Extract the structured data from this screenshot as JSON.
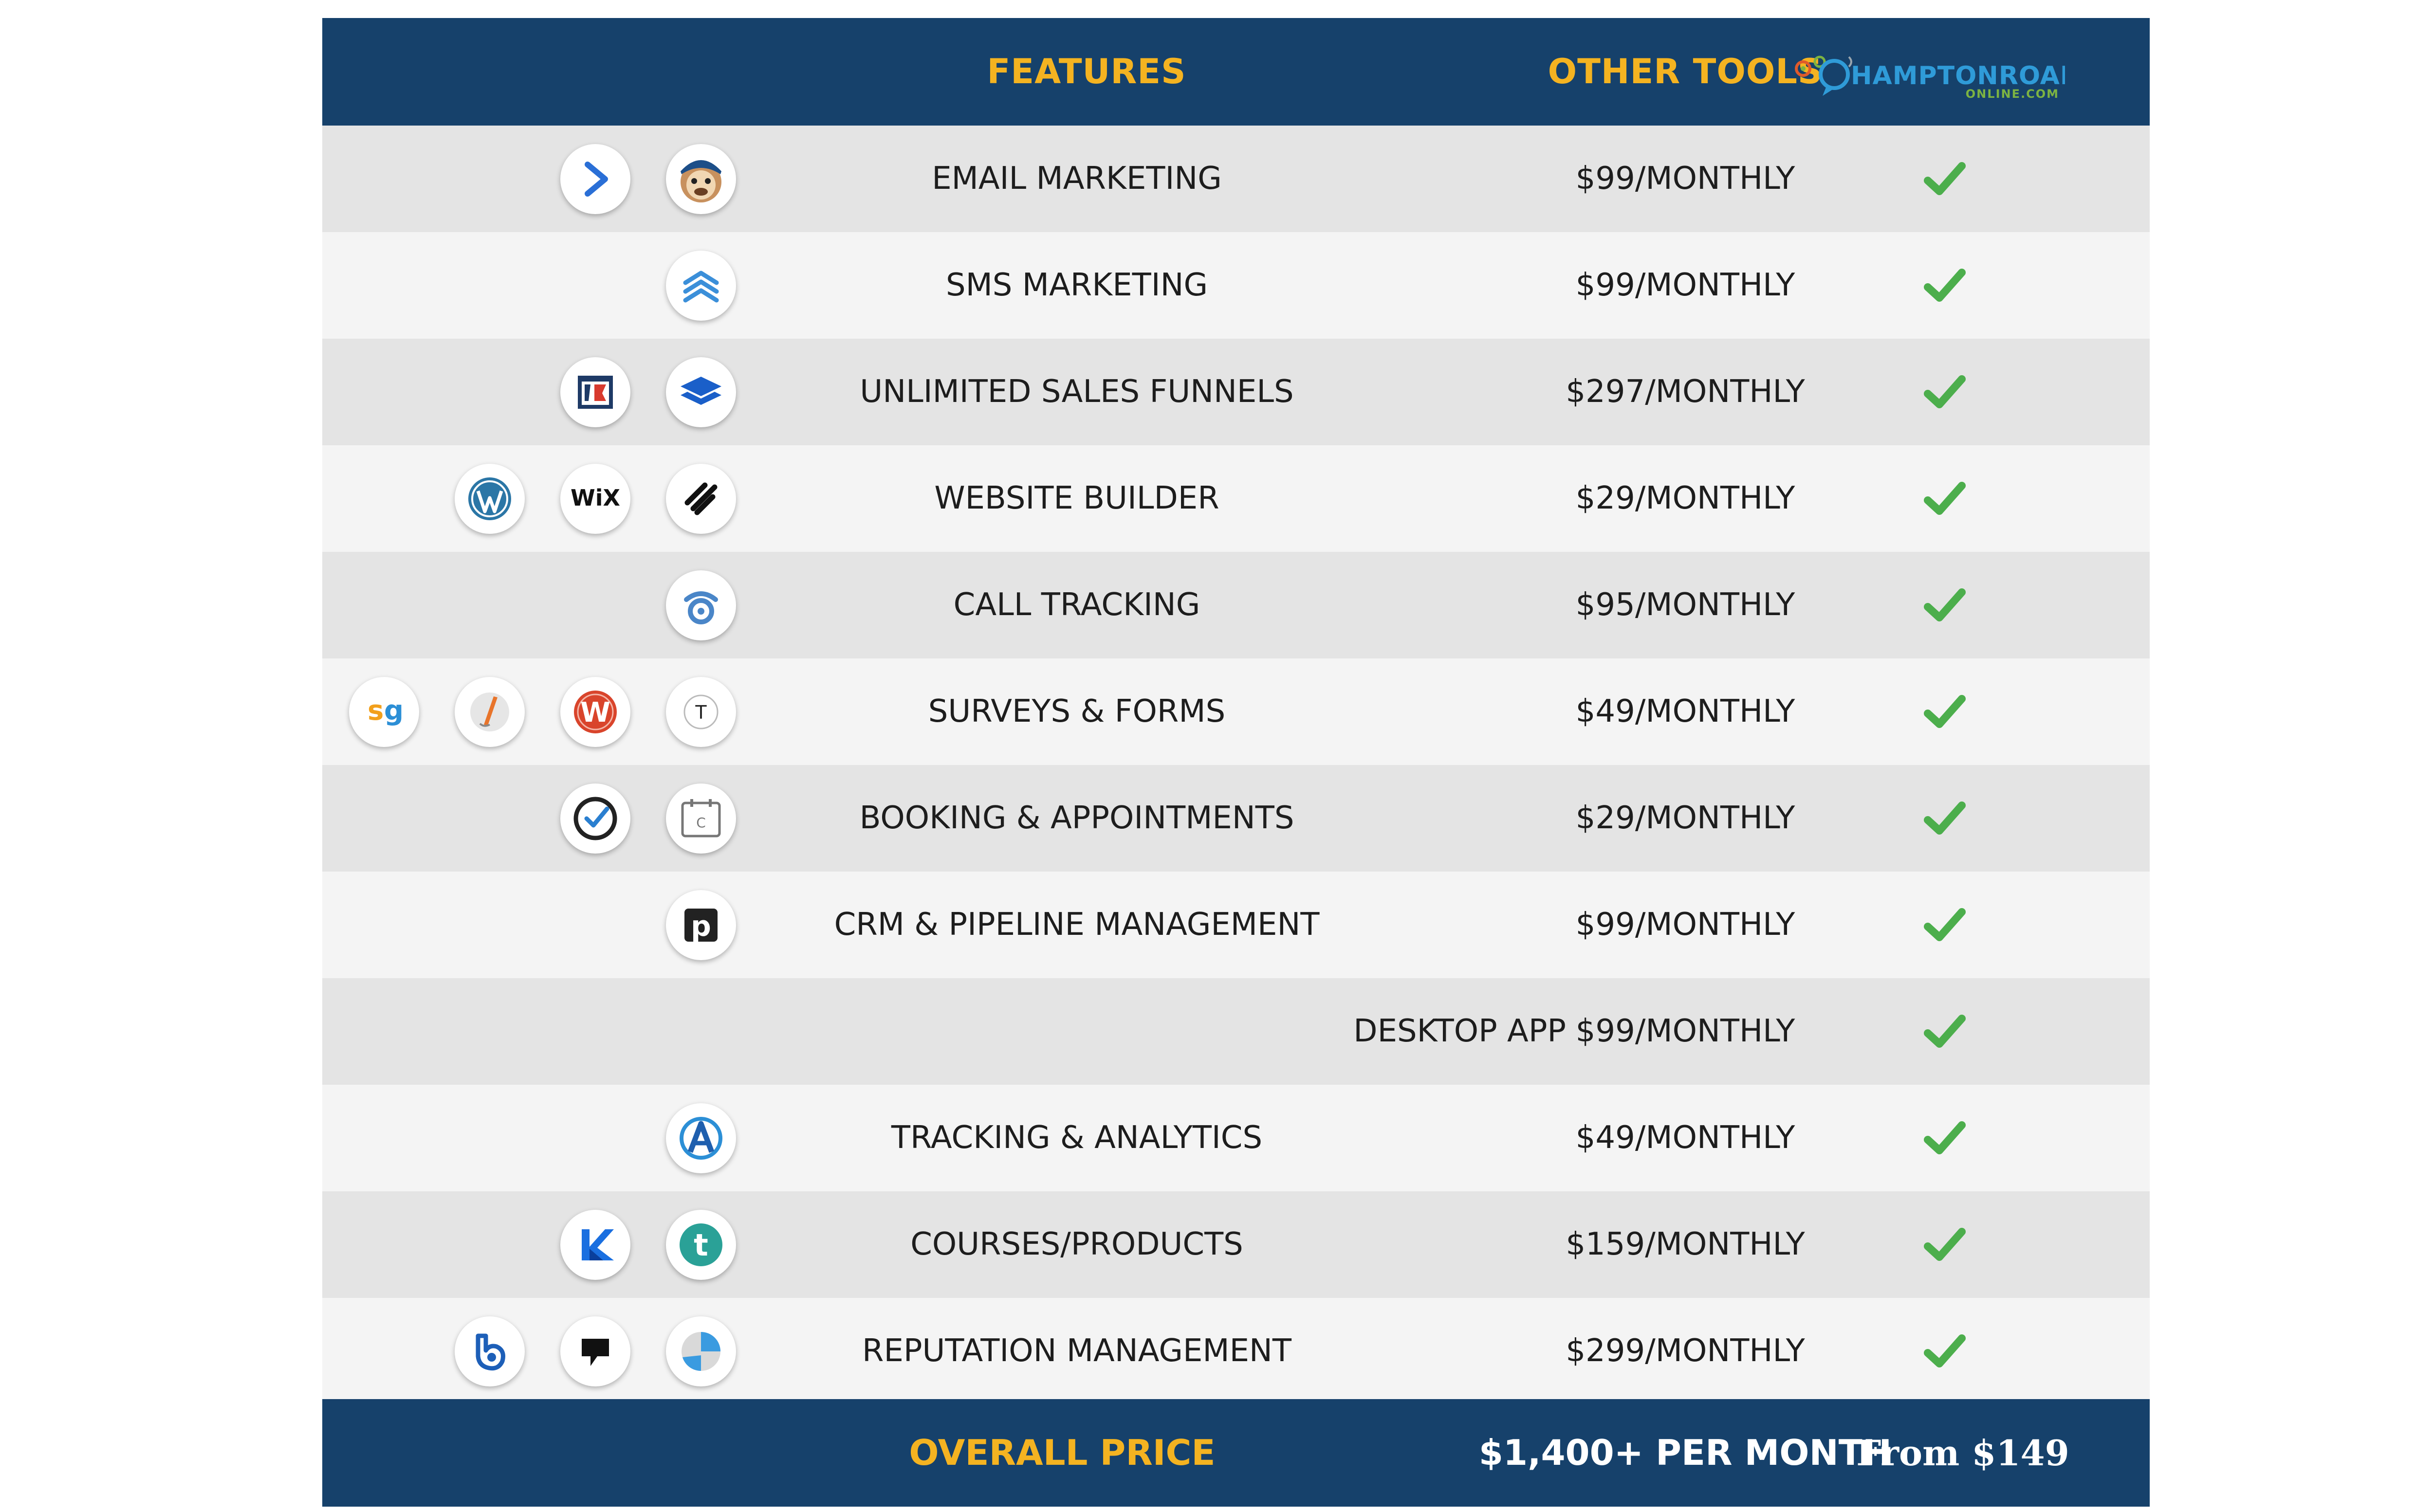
{
  "header": {
    "features": "FEATURES",
    "other_tools": "OTHER TOOLS",
    "logo": {
      "line1": "HAMPTONROADS",
      "line2": "ONLINE.COM"
    }
  },
  "rows": [
    {
      "feature": "EMAIL MARKETING",
      "price": "$99/MONTHLY",
      "included": true,
      "icons": [
        "activecampaign-icon",
        "mailchimp-icon"
      ]
    },
    {
      "feature": "SMS MARKETING",
      "price": "$99/MONTHLY",
      "included": true,
      "icons": [
        "chevron-stack-icon"
      ]
    },
    {
      "feature": "UNLIMITED SALES FUNNELS",
      "price": "$297/MONTHLY",
      "included": true,
      "icons": [
        "clickfunnels-icon",
        "layers-icon"
      ]
    },
    {
      "feature": "WEBSITE BUILDER",
      "price": "$29/MONTHLY",
      "included": true,
      "icons": [
        "wordpress-icon",
        "wix-icon",
        "squarespace-icon"
      ]
    },
    {
      "feature": "CALL TRACKING",
      "price": "$95/MONTHLY",
      "included": true,
      "icons": [
        "phone-tracking-icon"
      ]
    },
    {
      "feature": "SURVEYS & FORMS",
      "price": "$49/MONTHLY",
      "included": true,
      "icons": [
        "surveygizmo-icon",
        "formstack-icon",
        "wufoo-icon",
        "typeform-icon"
      ]
    },
    {
      "feature": "BOOKING & APPOINTMENTS",
      "price": "$29/MONTHLY",
      "included": true,
      "icons": [
        "acuity-check-icon",
        "calendly-icon"
      ]
    },
    {
      "feature": "CRM & PIPELINE MANAGEMENT",
      "price": "$99/MONTHLY",
      "included": true,
      "icons": [
        "pipedrive-icon"
      ]
    },
    {
      "feature": "DESKTOP APP",
      "price": "$99/MONTHLY",
      "included": true,
      "icons": []
    },
    {
      "feature": "TRACKING & ANALYTICS",
      "price": "$49/MONTHLY",
      "included": true,
      "icons": [
        "analytics-a-icon"
      ]
    },
    {
      "feature": "COURSES/PRODUCTS",
      "price": "$159/MONTHLY",
      "included": true,
      "icons": [
        "kajabi-icon",
        "teachable-icon"
      ]
    },
    {
      "feature": "REPUTATION MANAGEMENT",
      "price": "$299/MONTHLY",
      "included": true,
      "icons": [
        "birdeye-icon",
        "podium-icon",
        "reputation-icon"
      ]
    }
  ],
  "footer": {
    "label": "OVERALL PRICE",
    "other_total": "$1,400+ PER MONTH",
    "our_price": "From $149"
  },
  "colors": {
    "header_bg": "#16416b",
    "accent_gold": "#f4b321",
    "check_green": "#4cae4c",
    "row_shade": "#e4e4e4",
    "row_light": "#f4f4f4"
  }
}
